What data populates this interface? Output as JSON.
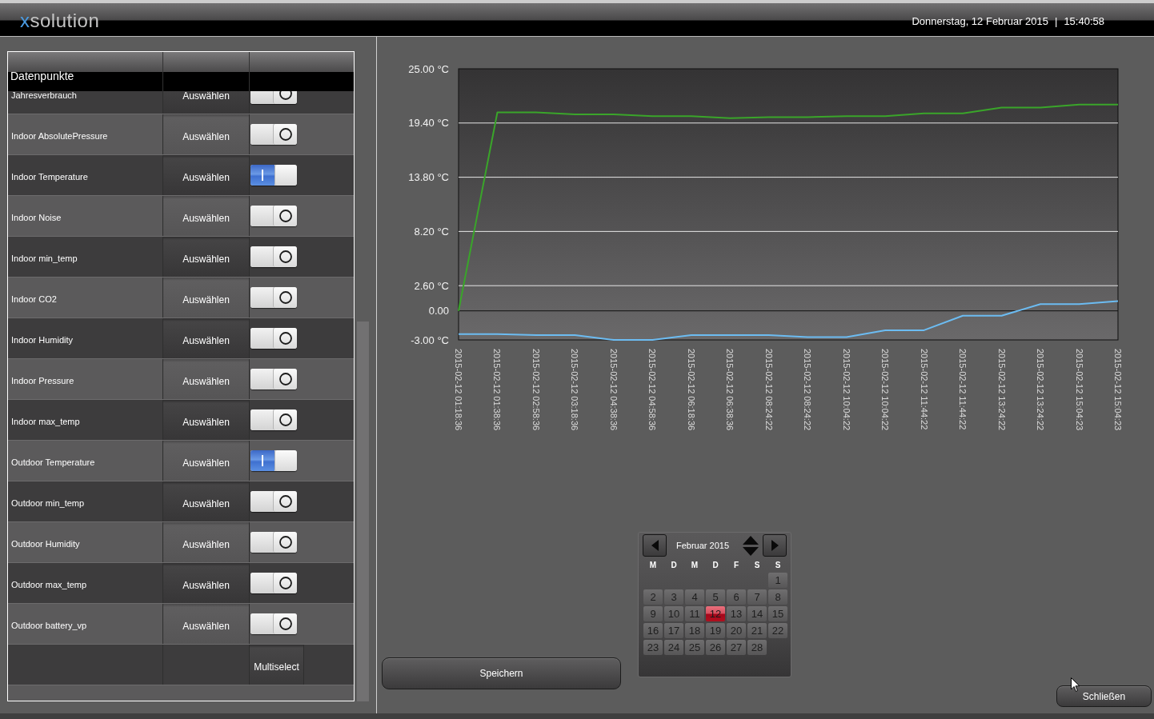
{
  "header": {
    "logo": {
      "accent": "x",
      "rest": "solution"
    },
    "date": "Donnerstag, 12 Februar 2015",
    "separator": "|",
    "time": "15:40:58"
  },
  "datapoints": {
    "title": "Datenpunkte",
    "rows": [
      {
        "name": "Jahresverbrauch",
        "action": "Auswählen",
        "on": false
      },
      {
        "name": "Indoor AbsolutePressure",
        "action": "Auswählen",
        "on": false
      },
      {
        "name": "Indoor Temperature",
        "action": "Auswählen",
        "on": true
      },
      {
        "name": "Indoor Noise",
        "action": "Auswählen",
        "on": false
      },
      {
        "name": "Indoor min_temp",
        "action": "Auswählen",
        "on": false
      },
      {
        "name": "Indoor CO2",
        "action": "Auswählen",
        "on": false
      },
      {
        "name": "Indoor Humidity",
        "action": "Auswählen",
        "on": false
      },
      {
        "name": "Indoor Pressure",
        "action": "Auswählen",
        "on": false
      },
      {
        "name": "Indoor max_temp",
        "action": "Auswählen",
        "on": false
      },
      {
        "name": "Outdoor Temperature",
        "action": "Auswählen",
        "on": true
      },
      {
        "name": "Outdoor min_temp",
        "action": "Auswählen",
        "on": false
      },
      {
        "name": "Outdoor Humidity",
        "action": "Auswählen",
        "on": false
      },
      {
        "name": "Outdoor max_temp",
        "action": "Auswählen",
        "on": false
      },
      {
        "name": "Outdoor battery_vp",
        "action": "Auswählen",
        "on": false
      }
    ],
    "multiselect": "Multiselect"
  },
  "chart": {
    "chart_data": {
      "type": "line",
      "categories": [
        "2015-02-12 01:18:36",
        "2015-02-12 01:38:36",
        "2015-02-12 02:58:36",
        "2015-02-12 03:18:36",
        "2015-02-12 04:38:36",
        "2015-02-12 04:58:36",
        "2015-02-12 06:18:36",
        "2015-02-12 06:38:36",
        "2015-02-12 08:24:22",
        "2015-02-12 08:24:22",
        "2015-02-12 10:04:22",
        "2015-02-12 10:04:22",
        "2015-02-12 11:44:22",
        "2015-02-12 11:44:22",
        "2015-02-12 13:24:22",
        "2015-02-12 13:24:22",
        "2015-02-12 15:04:23",
        "2015-02-12 15:04:23"
      ],
      "series": [
        {
          "color": "#3aa52a",
          "values": [
            0.0,
            20.5,
            20.5,
            20.3,
            20.3,
            20.1,
            20.1,
            19.9,
            20.0,
            20.0,
            20.1,
            20.1,
            20.4,
            20.4,
            21.0,
            21.0,
            21.3,
            21.3
          ]
        },
        {
          "color": "#6cbcf2",
          "values": [
            -2.4,
            -2.4,
            -2.5,
            -2.5,
            -3.0,
            -3.0,
            -2.5,
            -2.5,
            -2.5,
            -2.7,
            -2.7,
            -2.0,
            -2.0,
            -0.5,
            -0.5,
            0.7,
            0.7,
            1.0
          ]
        }
      ],
      "ylim": [
        -3,
        25
      ],
      "yticks": [
        {
          "value": 25,
          "label": "25.00 °C"
        },
        {
          "value": 19.4,
          "label": "19.40 °C"
        },
        {
          "value": 13.8,
          "label": "13.80 °C"
        },
        {
          "value": 8.2,
          "label": "8.20 °C"
        },
        {
          "value": 2.6,
          "label": "2.60 °C"
        },
        {
          "value": 0,
          "label": "0.00"
        },
        {
          "value": -3,
          "label": "-3.00 °C"
        }
      ],
      "grid": true
    }
  },
  "calendar": {
    "month": "Februar 2015",
    "weekdays": [
      "M",
      "D",
      "M",
      "D",
      "F",
      "S",
      "S"
    ],
    "weeks": [
      [
        {
          "day": "1",
          "selected": false
        }
      ],
      [
        {
          "day": "2",
          "selected": false
        },
        {
          "day": "3",
          "selected": false
        },
        {
          "day": "4",
          "selected": false
        },
        {
          "day": "5",
          "selected": false
        },
        {
          "day": "6",
          "selected": false
        },
        {
          "day": "7",
          "selected": false
        },
        {
          "day": "8",
          "selected": false
        }
      ],
      [
        {
          "day": "9",
          "selected": false
        },
        {
          "day": "10",
          "selected": false
        },
        {
          "day": "11",
          "selected": false
        },
        {
          "day": "12",
          "selected": true
        },
        {
          "day": "13",
          "selected": false
        },
        {
          "day": "14",
          "selected": false
        },
        {
          "day": "15",
          "selected": false
        }
      ],
      [
        {
          "day": "16",
          "selected": false
        },
        {
          "day": "17",
          "selected": false
        },
        {
          "day": "18",
          "selected": false
        },
        {
          "day": "19",
          "selected": false
        },
        {
          "day": "20",
          "selected": false
        },
        {
          "day": "21",
          "selected": false
        },
        {
          "day": "22",
          "selected": false
        }
      ],
      [
        {
          "day": "23",
          "selected": false
        },
        {
          "day": "24",
          "selected": false
        },
        {
          "day": "25",
          "selected": false
        },
        {
          "day": "26",
          "selected": false
        },
        {
          "day": "27",
          "selected": false
        },
        {
          "day": "28",
          "selected": false
        }
      ]
    ]
  },
  "buttons": {
    "save": "Speichern",
    "close": "Schließen"
  }
}
